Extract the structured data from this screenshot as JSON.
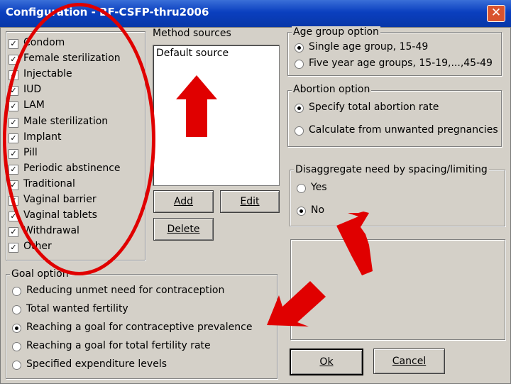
{
  "window": {
    "title": "Configuration - BF-CSFP-thru2006",
    "close_glyph": "✕"
  },
  "methods": {
    "items": [
      {
        "label": "Condom",
        "checked": true
      },
      {
        "label": "Female sterilization",
        "checked": true
      },
      {
        "label": "Injectable",
        "checked": true
      },
      {
        "label": "IUD",
        "checked": true
      },
      {
        "label": "LAM",
        "checked": true
      },
      {
        "label": "Male sterilization",
        "checked": true
      },
      {
        "label": "Implant",
        "checked": true
      },
      {
        "label": "Pill",
        "checked": true
      },
      {
        "label": "Periodic abstinence",
        "checked": true
      },
      {
        "label": "Traditional",
        "checked": true
      },
      {
        "label": "Vaginal barrier",
        "checked": true
      },
      {
        "label": "Vaginal tablets",
        "checked": true
      },
      {
        "label": "Withdrawal",
        "checked": true
      },
      {
        "label": "Other",
        "checked": true
      }
    ],
    "check_glyph": "✓"
  },
  "method_sources": {
    "label": "Method sources",
    "items": [
      "Default source"
    ],
    "add_label": "Add",
    "edit_label": "Edit",
    "delete_label": "Delete"
  },
  "age_group": {
    "label": "Age group option",
    "options": [
      "Single age group, 15-49",
      "Five year age groups, 15-19,...,45-49"
    ],
    "selected": 0
  },
  "abortion": {
    "label": "Abortion option",
    "options": [
      "Specify total abortion rate",
      "Calculate from unwanted pregnancies"
    ],
    "selected": 0
  },
  "disaggregate": {
    "label": "Disaggregate need by spacing/limiting",
    "options": [
      "Yes",
      "No"
    ],
    "selected": 1
  },
  "goal": {
    "label": "Goal option",
    "options": [
      "Reducing unmet need for contraception",
      "Total wanted fertility",
      "Reaching a goal for contraceptive prevalence",
      "Reaching a goal for total fertility rate",
      "Specified expenditure levels"
    ],
    "selected": 2
  },
  "actions": {
    "ok_label": "Ok",
    "cancel_label": "Cancel"
  },
  "annotation_colors": {
    "highlight": "#e00000"
  }
}
